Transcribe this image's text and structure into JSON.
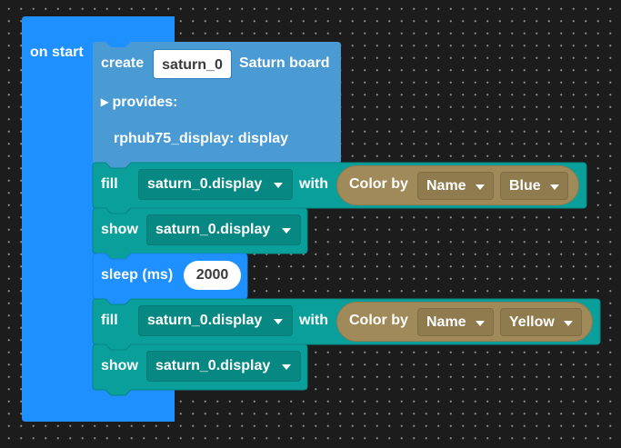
{
  "colors": {
    "background": "#1c1c1c",
    "event_block": "#1e90ff",
    "saturn_block": "#4a9ad4",
    "display_block": "#0a9f9a",
    "color_block": "#a08a5a",
    "dropdown_teal": "#078883",
    "dropdown_tan": "#8f7b4e"
  },
  "on_start": {
    "label": "on start"
  },
  "create_block": {
    "create_label": "create",
    "name_value": "saturn_0",
    "board_label": "Saturn board",
    "provides_label": "▸ provides:",
    "provides_item": "rphub75_display: display"
  },
  "fill_blue": {
    "fill_label": "fill",
    "target": "saturn_0.display",
    "with_label": "with",
    "color_by_label": "Color by",
    "mode": "Name",
    "color": "Blue"
  },
  "show_1": {
    "show_label": "show",
    "target": "saturn_0.display"
  },
  "sleep": {
    "label": "sleep (ms)",
    "value": "2000"
  },
  "fill_yellow": {
    "fill_label": "fill",
    "target": "saturn_0.display",
    "with_label": "with",
    "color_by_label": "Color by",
    "mode": "Name",
    "color": "Yellow"
  },
  "show_2": {
    "show_label": "show",
    "target": "saturn_0.display"
  }
}
